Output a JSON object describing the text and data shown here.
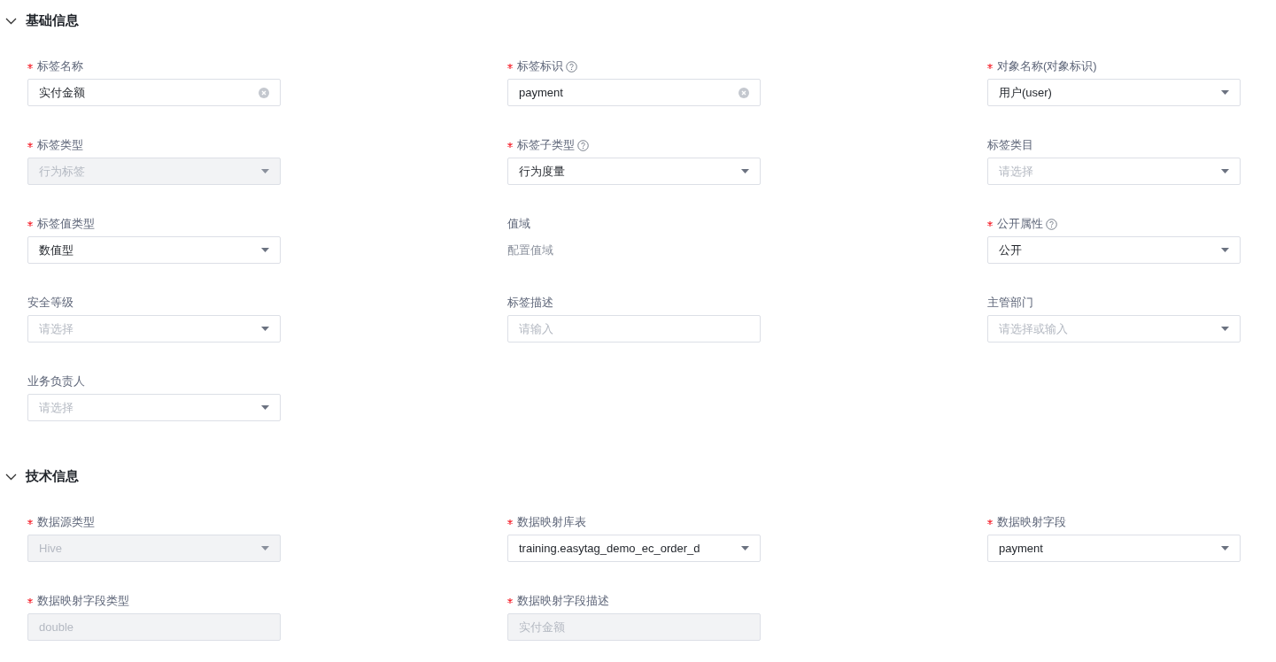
{
  "sections": [
    {
      "title": "基础信息",
      "expanded": true,
      "fields": [
        {
          "label": "标签名称",
          "required": true,
          "help": false,
          "kind": "input",
          "value": "实付金额",
          "clearable": true,
          "disabled": false
        },
        {
          "label": "标签标识",
          "required": true,
          "help": true,
          "kind": "input",
          "value": "payment",
          "clearable": true,
          "disabled": false
        },
        {
          "label": "对象名称(对象标识)",
          "required": true,
          "help": false,
          "kind": "select",
          "value": "用户(user)",
          "disabled": false
        },
        {
          "label": "标签类型",
          "required": true,
          "help": false,
          "kind": "select",
          "value": "行为标签",
          "disabled": true
        },
        {
          "label": "标签子类型",
          "required": true,
          "help": true,
          "kind": "select",
          "value": "行为度量",
          "disabled": false
        },
        {
          "label": "标签类目",
          "required": false,
          "help": false,
          "kind": "select",
          "placeholder": "请选择",
          "disabled": false
        },
        {
          "label": "标签值类型",
          "required": true,
          "help": false,
          "kind": "select",
          "value": "数值型",
          "disabled": false
        },
        {
          "label": "值域",
          "required": false,
          "help": false,
          "kind": "text",
          "value": "配置值域"
        },
        {
          "label": "公开属性",
          "required": true,
          "help": true,
          "kind": "select",
          "value": "公开",
          "disabled": false
        },
        {
          "label": "安全等级",
          "required": false,
          "help": false,
          "kind": "select",
          "placeholder": "请选择",
          "disabled": false
        },
        {
          "label": "标签描述",
          "required": false,
          "help": false,
          "kind": "input",
          "placeholder": "请输入",
          "clearable": false,
          "disabled": false
        },
        {
          "label": "主管部门",
          "required": false,
          "help": false,
          "kind": "select",
          "placeholder": "请选择或输入",
          "disabled": false
        },
        {
          "label": "业务负责人",
          "required": false,
          "help": false,
          "kind": "select",
          "placeholder": "请选择",
          "disabled": false
        }
      ]
    },
    {
      "title": "技术信息",
      "expanded": true,
      "fields": [
        {
          "label": "数据源类型",
          "required": true,
          "help": false,
          "kind": "select",
          "value": "Hive",
          "disabled": true
        },
        {
          "label": "数据映射库表",
          "required": true,
          "help": false,
          "kind": "select",
          "value": "training.easytag_demo_ec_order_d",
          "disabled": false
        },
        {
          "label": "数据映射字段",
          "required": true,
          "help": false,
          "kind": "select",
          "value": "payment",
          "disabled": false
        },
        {
          "label": "数据映射字段类型",
          "required": true,
          "help": false,
          "kind": "input",
          "value": "double",
          "clearable": false,
          "disabled": true
        },
        {
          "label": "数据映射字段描述",
          "required": true,
          "help": false,
          "kind": "input",
          "value": "实付金额",
          "clearable": false,
          "disabled": true
        }
      ]
    }
  ]
}
